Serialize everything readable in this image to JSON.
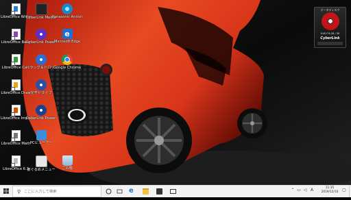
{
  "desktop": {
    "icons": [
      {
        "label": "LibreOffice Writer",
        "icon": "libreoffice-writer-icon"
      },
      {
        "label": "LibreOffice Base",
        "icon": "libreoffice-base-icon"
      },
      {
        "label": "LibreOffice Calc",
        "icon": "libreoffice-calc-icon"
      },
      {
        "label": "LibreOffice Draw",
        "icon": "libreoffice-draw-icon"
      },
      {
        "label": "LibreOffice Impress",
        "icon": "libreoffice-impress-icon"
      },
      {
        "label": "LibreOffice Math",
        "icon": "libreoffice-math-icon"
      },
      {
        "label": "LibreOffice 6.3",
        "icon": "libreoffice-folder-icon"
      },
      {
        "label": "CyberLink Media Suite 10",
        "icon": "cyberlink-media-suite-icon"
      },
      {
        "label": "CyberLink PowerDVD 12",
        "icon": "cyberlink-powerdvd-icon"
      },
      {
        "label": "ドラッグ＆ドロップで書き込み",
        "icon": "drag-drop-burn-icon"
      },
      {
        "label": "光学ドライブ",
        "icon": "optical-drive-icon"
      },
      {
        "label": "CyberLink PowerDVD 6",
        "icon": "cyberlink-powerdvd6-icon"
      },
      {
        "label": "PCビューアー",
        "icon": "pc-viewer-icon"
      },
      {
        "label": "書ぐるめメニュー",
        "icon": "menu-launcher-icon"
      },
      {
        "label": "Panasonic Antivirus",
        "icon": "antivirus-icon"
      },
      {
        "label": "Microsoft Edge",
        "icon": "edge-icon"
      },
      {
        "label": "Google Chrome",
        "icon": "chrome-icon"
      },
      {
        "label": "ごみ箱",
        "icon": "recycle-bin-icon"
      }
    ]
  },
  "gadget": {
    "title": "データディスク",
    "time": "0:00:74:26 / 30",
    "logo": "CyberLink"
  },
  "taskbar": {
    "search_placeholder": "ここに入力して検索",
    "clock_time": "11:35",
    "clock_date": "2019/12/10",
    "ime_label": "A"
  },
  "colors": {
    "wallpaper_car": "#e0361a",
    "taskbar_bg": "#f3f3f3"
  }
}
